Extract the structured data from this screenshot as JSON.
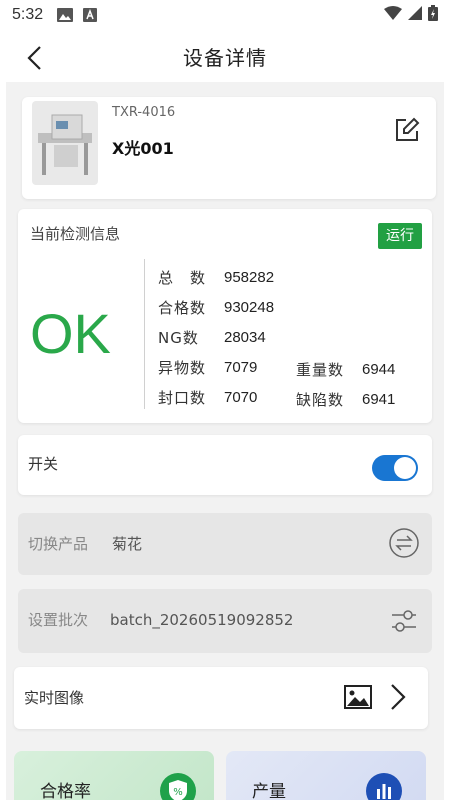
{
  "status_bar": {
    "time": "5:32"
  },
  "header": {
    "title": "设备详情"
  },
  "device": {
    "model": "TXR-4016",
    "name": "X光001"
  },
  "detection": {
    "title": "当前检测信息",
    "status": "运行",
    "result": "OK",
    "stats": {
      "total_label": "总　数",
      "total": "958282",
      "pass_label": "合格数",
      "pass": "930248",
      "ng_label": "NG数",
      "ng": "28034",
      "foreign_label": "异物数",
      "foreign": "7079",
      "weight_label": "重量数",
      "weight": "6944",
      "seal_label": "封口数",
      "seal": "7070",
      "defect_label": "缺陷数",
      "defect": "6941"
    }
  },
  "power": {
    "label": "开关",
    "on": true
  },
  "product": {
    "label": "切换产品",
    "value": "菊花"
  },
  "batch": {
    "label": "设置批次",
    "value": "batch_20260519092852"
  },
  "realtime": {
    "label": "实时图像"
  },
  "tiles": {
    "pass_rate": "合格率",
    "output": "产量"
  },
  "colors": {
    "accent": "#1976d2",
    "ok": "#2aa84a",
    "running": "#22a043"
  }
}
